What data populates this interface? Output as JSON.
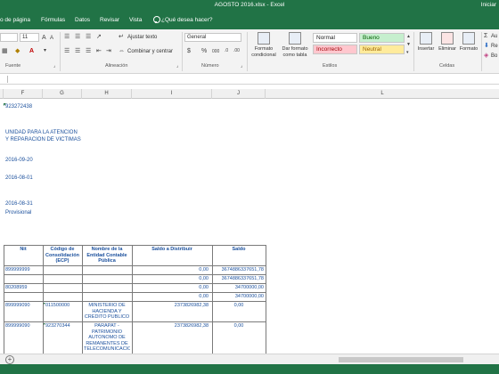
{
  "window": {
    "title": "AGOSTO 2016.xlsx - Excel",
    "user": "Iniciar"
  },
  "menu": {
    "tabs": [
      "o de página",
      "Fórmulas",
      "Datos",
      "Revisar",
      "Vista"
    ],
    "tell_me": "¿Qué desea hacer?"
  },
  "ribbon": {
    "font_size": "11",
    "wrap_text": "Ajustar texto",
    "merge_center": "Combinar y centrar",
    "number_format": "General",
    "currency": "$",
    "percent": "%",
    "thousands": "000",
    "conditional_format": "Formato condicional",
    "format_as_table": "Dar formato como tabla",
    "styles": {
      "normal": "Normal",
      "good": "Bueno",
      "bad": "Incorrecto",
      "neutral": "Neutral"
    },
    "insert": "Insertar",
    "delete": "Eliminar",
    "format": "Formato",
    "autosum": "Au",
    "fill": "Re",
    "clear": "Bo",
    "groups": {
      "font": "Fuente",
      "alignment": "Alineación",
      "number": "Número",
      "styles": "Estilos",
      "cells": "Celdas"
    }
  },
  "columns": [
    "F",
    "G",
    "H",
    "I",
    "J",
    "L"
  ],
  "sheet": {
    "top_values": {
      "nit": "923272438",
      "unit_line1": "UNIDAD PARA LA ATENCION",
      "unit_line2": "Y REPARACION DE VICTIMAS",
      "date1": "2016-09-20",
      "date2": "2016-08-01",
      "date3": "2016-08-31",
      "status": "Provisional"
    },
    "table": {
      "headers": [
        "Nit",
        "Código de Consolidación (ECP)",
        "Nombre de la Entidad Contable Pública",
        "Saldo a Distribuir",
        "Saldo"
      ],
      "rows": [
        [
          "899999999",
          "",
          "",
          "0,00",
          "3674886337651,78"
        ],
        [
          "",
          "",
          "",
          "0,00",
          "3674886337651,78"
        ],
        [
          "80208959",
          "",
          "",
          "0,00",
          "34700000,00"
        ],
        [
          "",
          "",
          "",
          "0,00",
          "34700000,00"
        ],
        [
          "899999090",
          "011500000",
          "MINISTERIO DE HACIENDA Y CREDITO PUBLICO",
          "2373826982,38",
          "0,00"
        ],
        [
          "899999090",
          "923270344",
          "PARAPAT - PATRIMONIO AUTONOMO DE REMANENTES DE TELECOMUNICACIONES",
          "2373826982,38",
          "0,00"
        ]
      ]
    }
  },
  "colors": {
    "excel_green": "#217346",
    "cell_text": "#1a4f9c"
  }
}
